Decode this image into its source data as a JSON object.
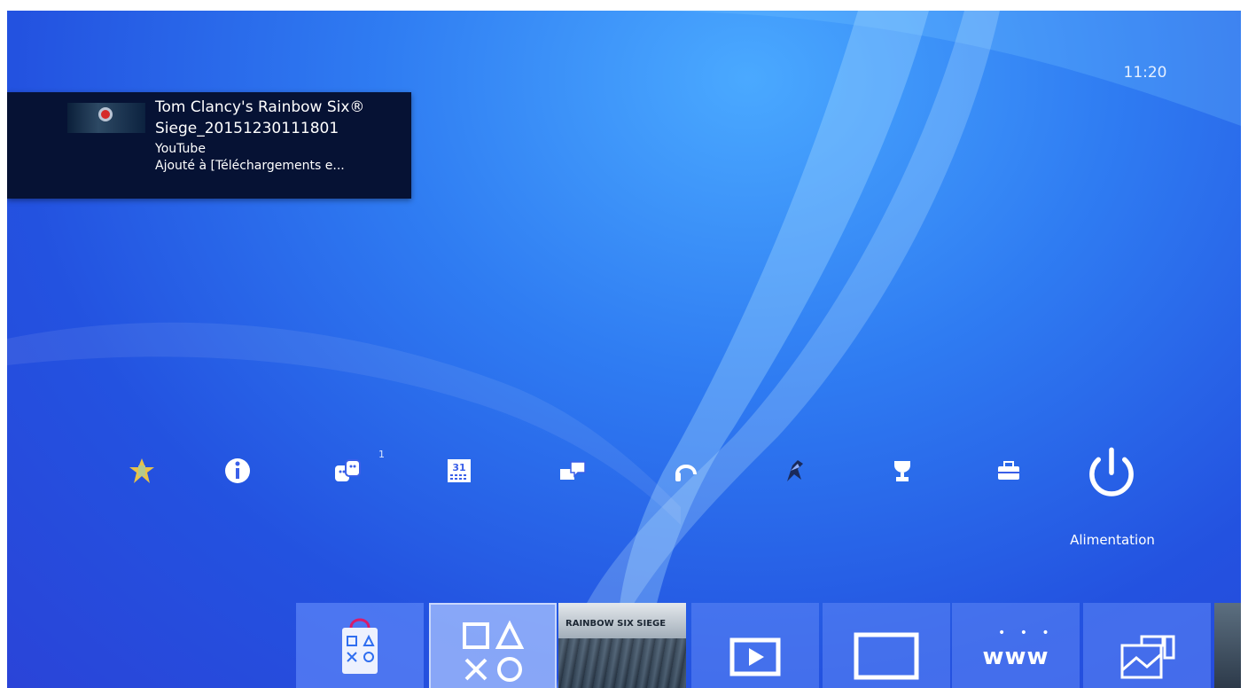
{
  "notification": {
    "title_line1": "Tom Clancy's Rainbow Six®",
    "title_line2": "Siege_20151230111801",
    "service": "YouTube",
    "status": "Ajouté à [Téléchargements e...",
    "thumbnail": "game-capture-thumbnail"
  },
  "clock": {
    "time": "11:20"
  },
  "function_area": {
    "items": [
      {
        "icon": "playstation-plus-icon"
      },
      {
        "icon": "info-icon"
      },
      {
        "icon": "friends-icon",
        "badge": "1"
      },
      {
        "icon": "calendar-icon",
        "icon_text": "31"
      },
      {
        "icon": "messages-icon"
      },
      {
        "icon": "party-headset-icon"
      },
      {
        "icon": "profile-avatar-icon"
      },
      {
        "icon": "trophy-icon"
      },
      {
        "icon": "settings-toolbox-icon"
      },
      {
        "icon": "power-icon",
        "label": "Alimentation",
        "selected": true
      }
    ]
  },
  "content_area": {
    "tiles": [
      {
        "name": "playstation-store",
        "icon": "store-bag-icon"
      },
      {
        "name": "library",
        "icon": "ps-shapes-icon"
      },
      {
        "name": "game",
        "title_art": "RAINBOW SIX SIEGE"
      },
      {
        "name": "tv-video",
        "icon": "play-screen-icon"
      },
      {
        "name": "video",
        "icon": "monitor-icon"
      },
      {
        "name": "internet-browser",
        "icon_text": "www"
      },
      {
        "name": "capture-gallery",
        "icon": "gallery-icon"
      }
    ]
  },
  "colors": {
    "background": "#2f6ef0",
    "notification_bg": "#061234",
    "text": "#ffffff"
  }
}
